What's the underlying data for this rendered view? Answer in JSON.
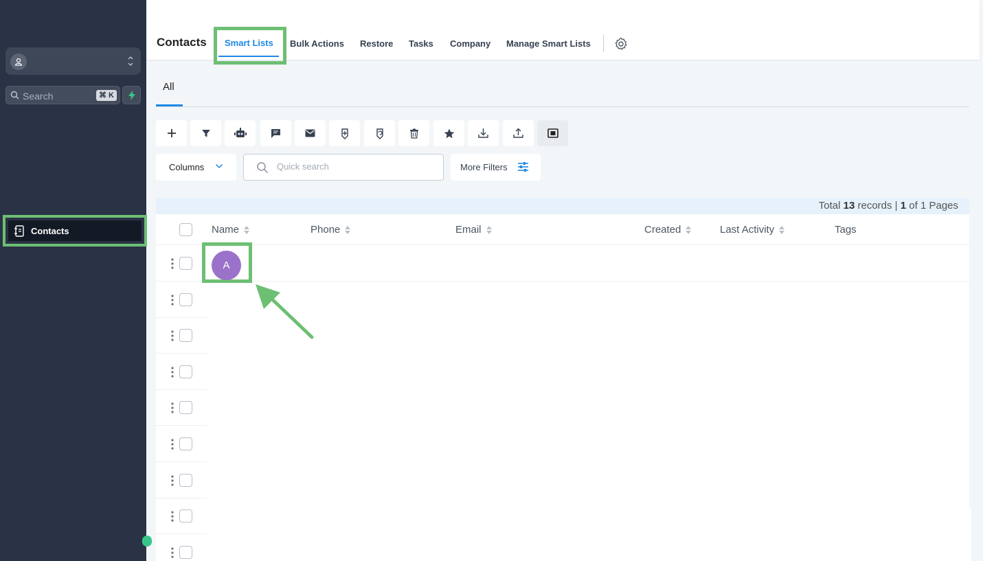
{
  "sidebar": {
    "search": {
      "placeholder": "Search",
      "shortcut": "⌘ K"
    },
    "nav": {
      "contacts_label": "Contacts"
    }
  },
  "header": {
    "title": "Contacts",
    "tabs": [
      {
        "label": "Smart Lists",
        "active": true
      },
      {
        "label": "Bulk Actions"
      },
      {
        "label": "Restore"
      },
      {
        "label": "Tasks"
      },
      {
        "label": "Company"
      },
      {
        "label": "Manage Smart Lists"
      }
    ]
  },
  "subtabs": [
    {
      "label": "All",
      "active": true
    }
  ],
  "toolbar": {
    "icons": [
      "plus-icon",
      "filter-icon",
      "robot-icon",
      "chat-icon",
      "email-icon",
      "tag-add-icon",
      "tag-remove-icon",
      "trash-icon",
      "star-icon",
      "download-icon",
      "upload-icon",
      "merge-icon"
    ],
    "columns_label": "Columns",
    "quick_search_placeholder": "Quick search",
    "more_filters_label": "More Filters"
  },
  "table": {
    "summary": {
      "prefix": "Total",
      "total": "13",
      "records_label": "records |",
      "page": "1",
      "of_label": "of 1 Pages"
    },
    "columns": [
      "Name",
      "Phone",
      "Email",
      "Created",
      "Last Activity",
      "Tags"
    ],
    "rows": [
      {
        "avatar_initial": "A"
      }
    ]
  },
  "colors": {
    "accent": "#1e88e5",
    "highlight": "#6dbf73",
    "sidebar": "#2a3345",
    "avatar": "#9b72c9"
  }
}
